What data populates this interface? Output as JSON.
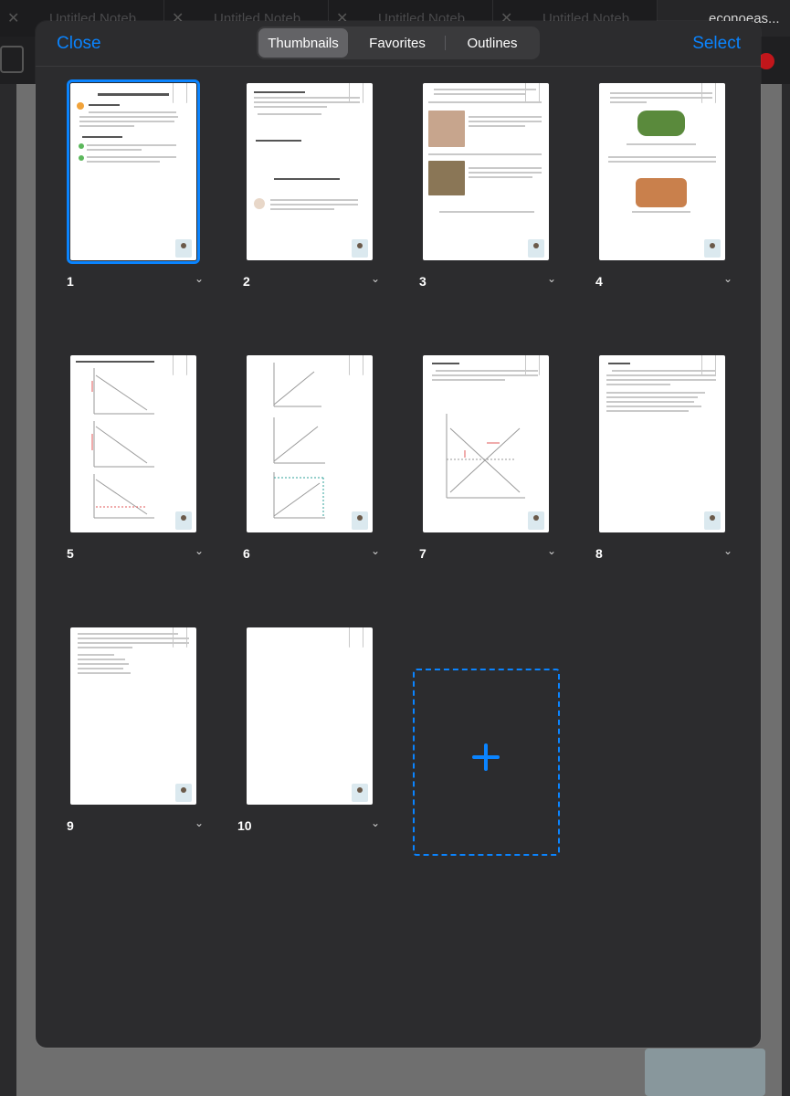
{
  "background": {
    "tabs": [
      "Untitled Noteb",
      "Untitled Noteb",
      "Untitled Noteb",
      "Untitled Noteb",
      "econoeas..."
    ]
  },
  "header": {
    "close_label": "Close",
    "select_label": "Select",
    "segments": [
      "Thumbnails",
      "Favorites",
      "Outlines"
    ],
    "selected_segment": "Thumbnails"
  },
  "pages": [
    {
      "number": "1",
      "selected": true
    },
    {
      "number": "2"
    },
    {
      "number": "3"
    },
    {
      "number": "4"
    },
    {
      "number": "5"
    },
    {
      "number": "6"
    },
    {
      "number": "7"
    },
    {
      "number": "8"
    },
    {
      "number": "9"
    },
    {
      "number": "10"
    }
  ],
  "colors": {
    "accent": "#0a84ff",
    "modal_bg": "#2c2c2e",
    "segment_selected": "#636366"
  }
}
